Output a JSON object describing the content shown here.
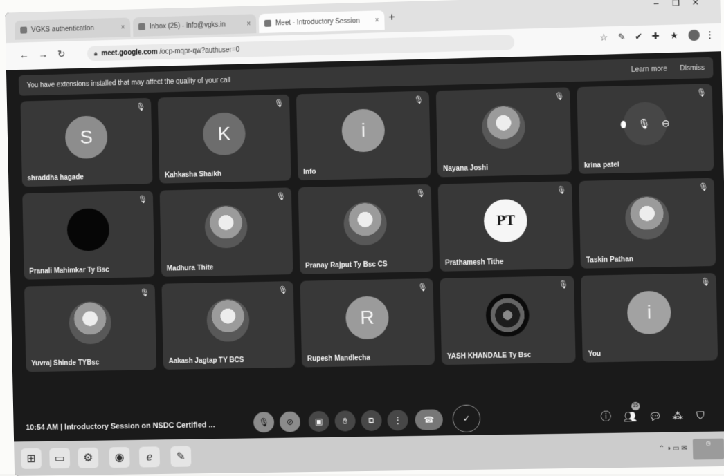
{
  "browser": {
    "tabs": [
      {
        "label": "VGKS authentication"
      },
      {
        "label": "Inbox (25) - info@vgks.in"
      },
      {
        "label": "Meet - Introductory Session"
      }
    ],
    "url_host": "meet.google.com",
    "url_path": "/ocp-mqpr-qw?authuser=0"
  },
  "banner": {
    "message": "You have extensions installed that may affect the quality of your call",
    "learn_more": "Learn more",
    "dismiss": "Dismiss"
  },
  "participants": [
    {
      "name": "shraddha hagade",
      "avatar": "S"
    },
    {
      "name": "Kahkasha Shaikh",
      "avatar": "K"
    },
    {
      "name": "Info",
      "avatar": "i"
    },
    {
      "name": "Nayana Joshi",
      "avatar": ""
    },
    {
      "name": "krina patel",
      "avatar": ""
    },
    {
      "name": "Pranali Mahimkar Ty Bsc",
      "avatar": ""
    },
    {
      "name": "Madhura Thite",
      "avatar": ""
    },
    {
      "name": "Pranay Rajput Ty Bsc CS",
      "avatar": ""
    },
    {
      "name": "Prathamesh Tithe",
      "avatar": "PT"
    },
    {
      "name": "Taskin Pathan",
      "avatar": ""
    },
    {
      "name": "Yuvraj Shinde TYBsc",
      "avatar": ""
    },
    {
      "name": "Aakash Jagtap TY BCS",
      "avatar": ""
    },
    {
      "name": "Rupesh Mandlecha",
      "avatar": "R"
    },
    {
      "name": "YASH KHANDALE Ty Bsc",
      "avatar": ""
    },
    {
      "name": "You",
      "avatar": "i"
    }
  ],
  "meeting": {
    "time": "10:54 AM",
    "separator": "|",
    "title": "Introductory Session on NSDC Certified ..."
  },
  "people_count": "15",
  "icons": {
    "mic_off": "mic-off-icon",
    "camera_off": "camera-off-icon",
    "captions": "captions-icon",
    "raise_hand": "raise-hand-icon",
    "present": "present-icon",
    "more": "more-icon",
    "end_call": "end-call-icon"
  }
}
